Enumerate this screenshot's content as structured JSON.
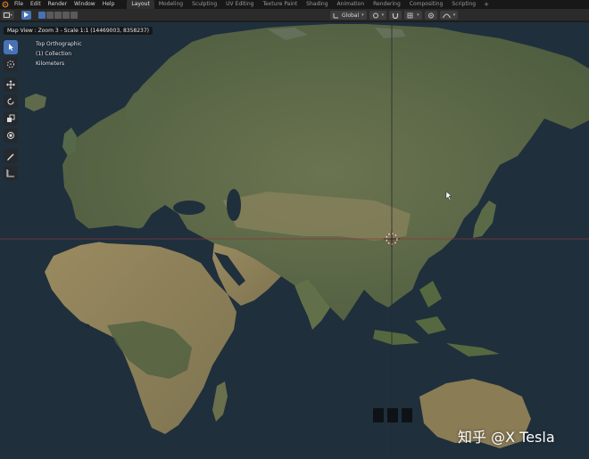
{
  "colors": {
    "ocean": "#1f2f3c",
    "land": "#5b6a48",
    "land_dry": "#8a8058",
    "accent": "#4772b3",
    "axis_red": "#8a3a3a"
  },
  "topbar": {
    "menu": [
      "File",
      "Edit",
      "Render",
      "Window",
      "Help"
    ],
    "workspaces": [
      "Layout",
      "Modeling",
      "Sculpting",
      "UV Editing",
      "Texture Paint",
      "Shading",
      "Animation",
      "Rendering",
      "Compositing",
      "Scripting"
    ],
    "active_workspace": "Layout",
    "add_tab": "+"
  },
  "header": {
    "orientation": "Global"
  },
  "viewport": {
    "tooltip": "Map View : Zoom 3 - Scale 1:1 (14469003, 8358237)",
    "view_name": "Top Orthographic",
    "collection": "(1) Collection",
    "units": "Kilometers"
  },
  "toolbar": {
    "tools": [
      "select-icon",
      "cursor-icon",
      "move-icon",
      "rotate-icon",
      "scale-icon",
      "transform-icon",
      "annotate-icon",
      "measure-icon"
    ]
  },
  "watermark": "知乎 @X Tesla"
}
